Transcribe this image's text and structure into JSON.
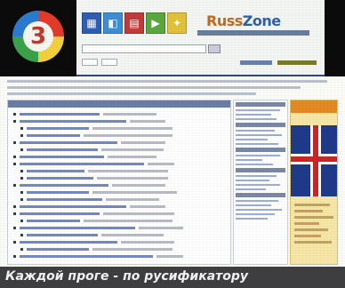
{
  "caption": "Каждой проге - по русификатору",
  "header": {
    "logo_icon": "number-3-ring-logo",
    "brand_part_a": "Russ",
    "brand_part_b": "Zone",
    "toolbar_icons": [
      "windows-icon",
      "palette-icon",
      "folder-icon",
      "media-icon",
      "lightbulb-icon"
    ]
  },
  "colors": {
    "header_rule": "#2e4a7a",
    "link": "#3f62b8",
    "caption_bg": "#3e3e40",
    "ad_bg": "#f7e7a6"
  }
}
